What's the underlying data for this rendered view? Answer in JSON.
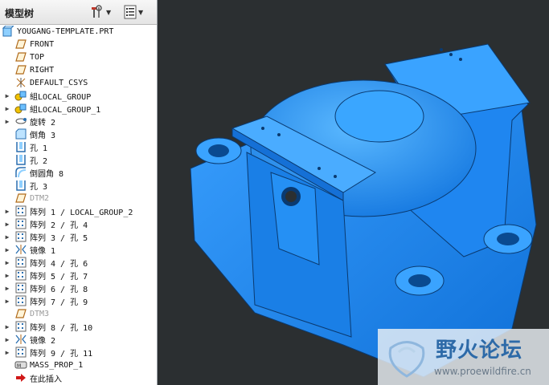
{
  "panel": {
    "title": "模型树",
    "tools_icon": "tools-icon",
    "settings_icon": "tree-settings-icon"
  },
  "tree": [
    {
      "label": "YOUGANG-TEMPLATE.PRT",
      "icon": "part-icon",
      "expandable": false,
      "dim": false
    },
    {
      "label": "FRONT",
      "icon": "datum-plane-icon",
      "expandable": false,
      "dim": false
    },
    {
      "label": "TOP",
      "icon": "datum-plane-icon",
      "expandable": false,
      "dim": false
    },
    {
      "label": "RIGHT",
      "icon": "datum-plane-icon",
      "expandable": false,
      "dim": false
    },
    {
      "label": "DEFAULT_CSYS",
      "icon": "csys-icon",
      "expandable": false,
      "dim": false
    },
    {
      "label": "組LOCAL_GROUP",
      "icon": "group-icon",
      "expandable": true,
      "dim": false
    },
    {
      "label": "組LOCAL_GROUP_1",
      "icon": "group-icon",
      "expandable": true,
      "dim": false
    },
    {
      "label": "旋转 2",
      "icon": "revolve-icon",
      "expandable": true,
      "dim": false
    },
    {
      "label": "倒角 3",
      "icon": "chamfer-icon",
      "expandable": false,
      "dim": false
    },
    {
      "label": "孔 1",
      "icon": "hole-icon",
      "expandable": false,
      "dim": false
    },
    {
      "label": "孔 2",
      "icon": "hole-icon",
      "expandable": false,
      "dim": false
    },
    {
      "label": "倒圆角 8",
      "icon": "round-icon",
      "expandable": false,
      "dim": false
    },
    {
      "label": "孔 3",
      "icon": "hole-icon",
      "expandable": false,
      "dim": false
    },
    {
      "label": "DTM2",
      "icon": "datum-plane-icon",
      "expandable": false,
      "dim": true
    },
    {
      "label": "阵列 1 / LOCAL_GROUP_2",
      "icon": "pattern-icon",
      "expandable": true,
      "dim": false
    },
    {
      "label": "阵列 2 / 孔 4",
      "icon": "pattern-icon",
      "expandable": true,
      "dim": false
    },
    {
      "label": "阵列 3 / 孔 5",
      "icon": "pattern-icon",
      "expandable": true,
      "dim": false
    },
    {
      "label": "镜像 1",
      "icon": "mirror-icon",
      "expandable": true,
      "dim": false
    },
    {
      "label": "阵列 4 / 孔 6",
      "icon": "pattern-icon",
      "expandable": true,
      "dim": false
    },
    {
      "label": "阵列 5 / 孔 7",
      "icon": "pattern-icon",
      "expandable": true,
      "dim": false
    },
    {
      "label": "阵列 6 / 孔 8",
      "icon": "pattern-icon",
      "expandable": true,
      "dim": false
    },
    {
      "label": "阵列 7 / 孔 9",
      "icon": "pattern-icon",
      "expandable": true,
      "dim": false
    },
    {
      "label": "DTM3",
      "icon": "datum-plane-icon",
      "expandable": false,
      "dim": true
    },
    {
      "label": "阵列 8 / 孔 10",
      "icon": "pattern-icon",
      "expandable": true,
      "dim": false
    },
    {
      "label": "镜像 2",
      "icon": "mirror-icon",
      "expandable": true,
      "dim": false
    },
    {
      "label": "阵列 9 / 孔 11",
      "icon": "pattern-icon",
      "expandable": true,
      "dim": false
    },
    {
      "label": "MASS_PROP_1",
      "icon": "analysis-icon",
      "expandable": false,
      "dim": false
    },
    {
      "label": "在此插入",
      "icon": "insert-arrow-icon",
      "expandable": false,
      "dim": false
    }
  ],
  "viewport": {
    "model_color": "#1e90ff",
    "background_color": "#2b2f31"
  },
  "watermark": {
    "text": "野火论坛",
    "url": "www.proewildfire.cn"
  }
}
